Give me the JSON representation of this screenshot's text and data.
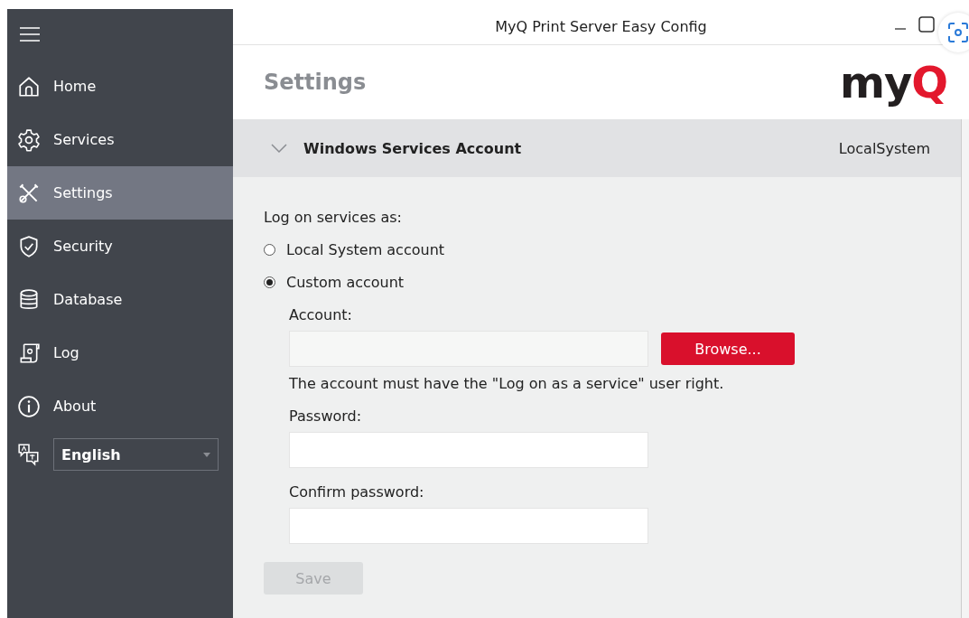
{
  "window": {
    "title": "MyQ Print Server Easy Config"
  },
  "sidebar": {
    "items": [
      {
        "label": "Home",
        "selected": false
      },
      {
        "label": "Services",
        "selected": false
      },
      {
        "label": "Settings",
        "selected": true
      },
      {
        "label": "Security",
        "selected": false
      },
      {
        "label": "Database",
        "selected": false
      },
      {
        "label": "Log",
        "selected": false
      },
      {
        "label": "About",
        "selected": false
      }
    ],
    "language": {
      "value": "English"
    }
  },
  "header": {
    "title": "Settings",
    "logo": [
      {
        "text": "my",
        "color": "#231f20"
      },
      {
        "text": "Q",
        "color": "#e3182d"
      }
    ]
  },
  "section": {
    "title": "Windows Services Account",
    "value": "LocalSystem",
    "expanded": true,
    "prompt": "Log on services as:",
    "options": [
      {
        "label": "Local System account",
        "selected": false
      },
      {
        "label": "Custom account",
        "selected": true
      }
    ],
    "account_label": "Account:",
    "browse": "Browse...",
    "hint": "The account must have the \"Log on as a service\" user right.",
    "password_label": "Password:",
    "confirm_label": "Confirm password:",
    "save": {
      "label": "Save",
      "disabled": true
    }
  }
}
